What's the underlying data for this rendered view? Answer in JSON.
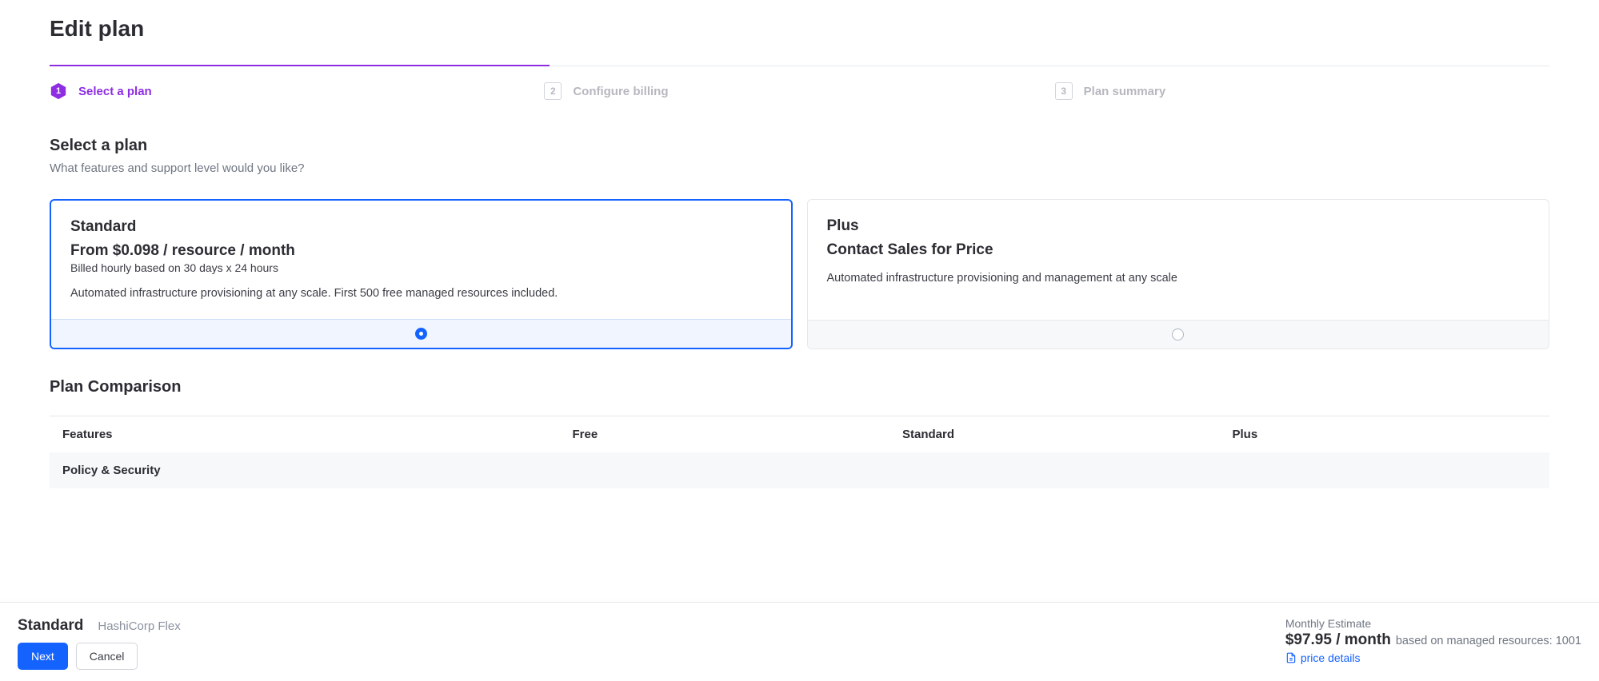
{
  "page": {
    "title": "Edit plan"
  },
  "stepper": {
    "steps": [
      {
        "num": "1",
        "label": "Select a plan"
      },
      {
        "num": "2",
        "label": "Configure billing"
      },
      {
        "num": "3",
        "label": "Plan summary"
      }
    ]
  },
  "section": {
    "heading": "Select a plan",
    "sub": "What features and support level would you like?"
  },
  "plans": {
    "standard": {
      "name": "Standard",
      "price": "From $0.098 / resource / month",
      "price_sub": "Billed hourly based on 30 days x 24 hours",
      "desc": "Automated infrastructure provisioning at any scale. First 500 free managed resources included."
    },
    "plus": {
      "name": "Plus",
      "price": "Contact Sales for Price",
      "desc": "Automated infrastructure provisioning and management at any scale"
    }
  },
  "comparison": {
    "heading": "Plan Comparison",
    "columns": [
      "Features",
      "Free",
      "Standard",
      "Plus"
    ],
    "section_row": "Policy & Security"
  },
  "footer": {
    "plan_name": "Standard",
    "plan_sub": "HashiCorp Flex",
    "next_label": "Next",
    "cancel_label": "Cancel",
    "estimate_label": "Monthly Estimate",
    "estimate_price": "$97.95 / month",
    "estimate_detail": "based on managed resources: 1001",
    "price_details": "price details"
  }
}
